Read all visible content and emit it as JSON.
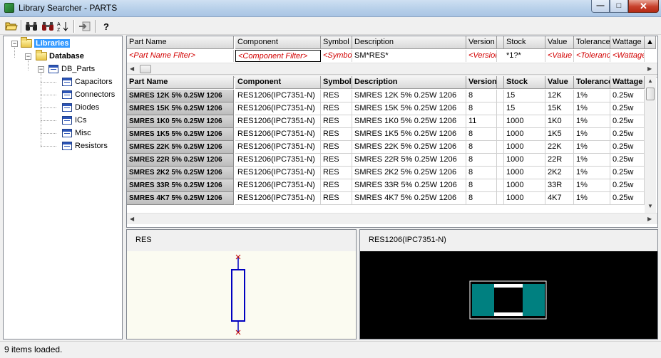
{
  "window": {
    "title": "Library Searcher - PARTS"
  },
  "toolbar": {
    "icons": [
      "open-folder-icon",
      "binoculars-icon",
      "binoculars-multi-icon",
      "sort-icon",
      "export-icon",
      "help-icon"
    ],
    "help_label": "?"
  },
  "tree": {
    "root": "Libraries",
    "database": "Database",
    "db_parts": "DB_Parts",
    "items": [
      "Capacitors",
      "Connectors",
      "Diodes",
      "ICs",
      "Misc",
      "Resistors"
    ]
  },
  "columns": [
    "Part Name",
    "Component",
    "Symbol",
    "Description",
    "Version",
    "Stock",
    "Value",
    "Tolerance",
    "Wattage"
  ],
  "filters": [
    "<Part Name Filter>",
    "<Component Filter>",
    "<Symbo",
    "SM*RES*",
    "<Version",
    "*1?*",
    "<Value",
    "<Toleranc",
    "<Wattage"
  ],
  "rows": [
    [
      "SMRES 12K 5% 0.25W 1206",
      "RES1206(IPC7351-N)",
      "RES",
      "SMRES 12K 5% 0.25W 1206",
      "8",
      "15",
      "12K",
      "1%",
      "0.25w"
    ],
    [
      "SMRES 15K 5% 0.25W 1206",
      "RES1206(IPC7351-N)",
      "RES",
      "SMRES 15K 5% 0.25W 1206",
      "8",
      "15",
      "15K",
      "1%",
      "0.25w"
    ],
    [
      "SMRES 1K0 5% 0.25W 1206",
      "RES1206(IPC7351-N)",
      "RES",
      "SMRES 1K0 5% 0.25W 1206",
      "11",
      "1000",
      "1K0",
      "1%",
      "0.25w"
    ],
    [
      "SMRES 1K5 5% 0.25W 1206",
      "RES1206(IPC7351-N)",
      "RES",
      "SMRES 1K5 5% 0.25W 1206",
      "8",
      "1000",
      "1K5",
      "1%",
      "0.25w"
    ],
    [
      "SMRES 22K 5% 0.25W 1206",
      "RES1206(IPC7351-N)",
      "RES",
      "SMRES 22K 5% 0.25W 1206",
      "8",
      "1000",
      "22K",
      "1%",
      "0.25w"
    ],
    [
      "SMRES 22R 5% 0.25W 1206",
      "RES1206(IPC7351-N)",
      "RES",
      "SMRES 22R 5% 0.25W 1206",
      "8",
      "1000",
      "22R",
      "1%",
      "0.25w"
    ],
    [
      "SMRES 2K2 5% 0.25W 1206",
      "RES1206(IPC7351-N)",
      "RES",
      "SMRES 2K2 5% 0.25W 1206",
      "8",
      "1000",
      "2K2",
      "1%",
      "0.25w"
    ],
    [
      "SMRES 33R 5% 0.25W 1206",
      "RES1206(IPC7351-N)",
      "RES",
      "SMRES 33R 5% 0.25W 1206",
      "8",
      "1000",
      "33R",
      "1%",
      "0.25w"
    ],
    [
      "SMRES 4K7 5% 0.25W 1206",
      "RES1206(IPC7351-N)",
      "RES",
      "SMRES 4K7 5% 0.25W 1206",
      "8",
      "1000",
      "4K7",
      "1%",
      "0.25w"
    ]
  ],
  "preview": {
    "symbol_name": "RES",
    "footprint_name": "RES1206(IPC7351-N)"
  },
  "colors": {
    "filter_text": "#d20000",
    "footprint_pad": "#008080",
    "symbol_body": "#0000c0",
    "symbol_pin_end": "#c00000"
  },
  "status": {
    "text": "9 items loaded."
  }
}
